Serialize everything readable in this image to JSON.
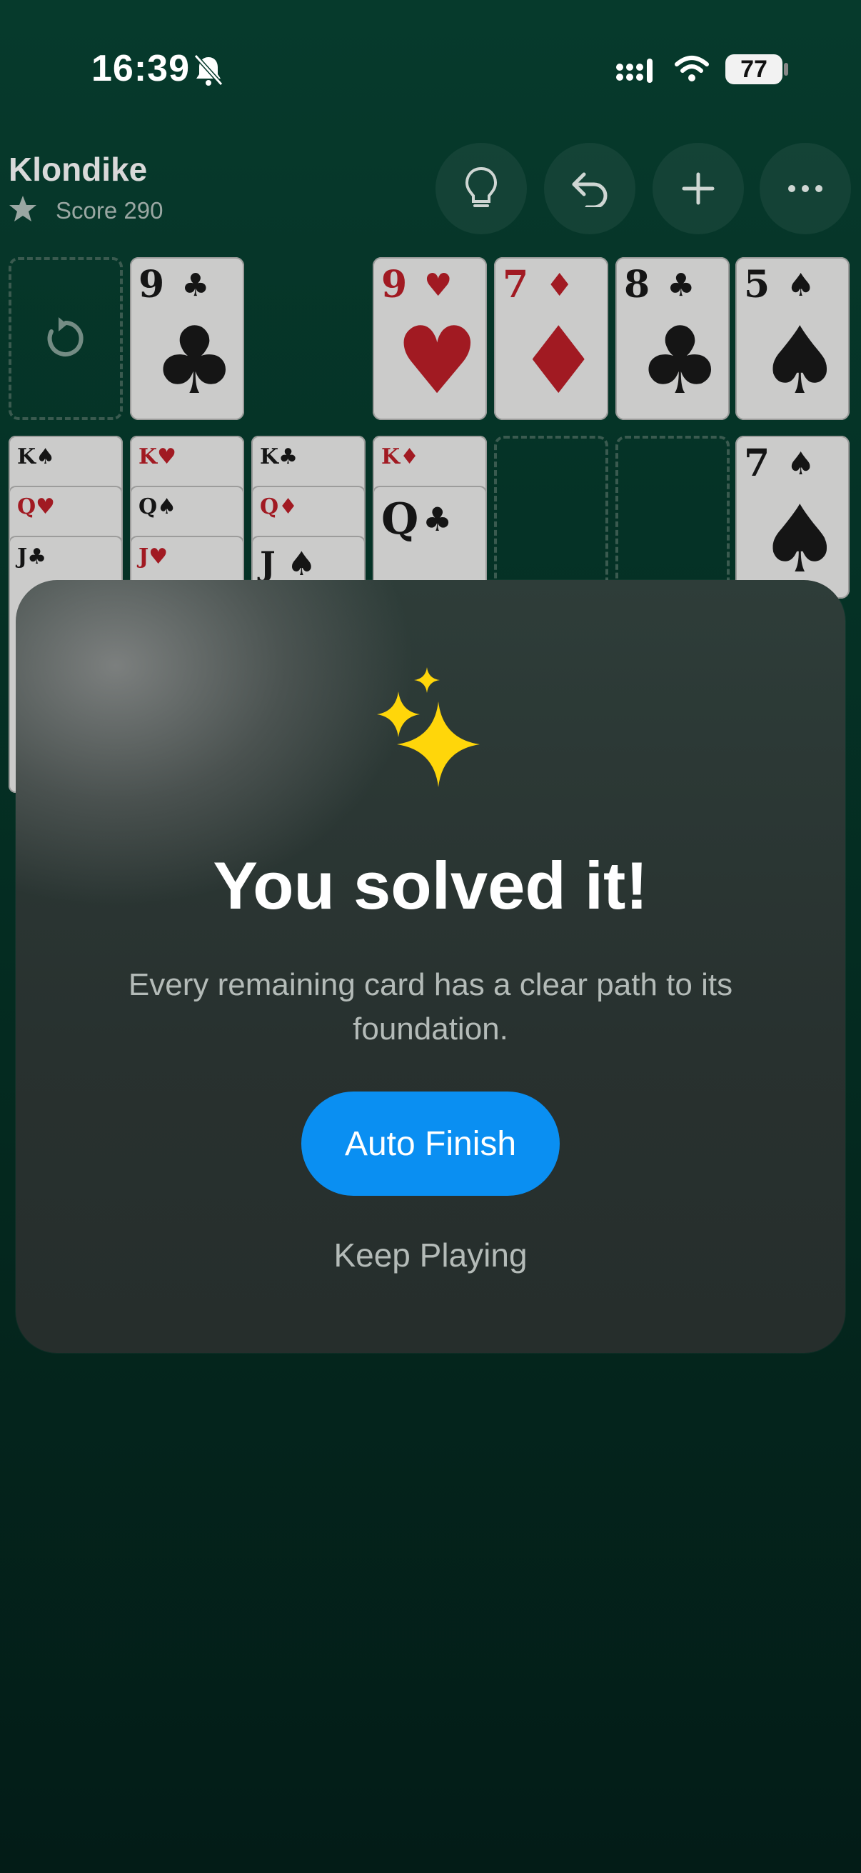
{
  "status_bar": {
    "time": "16:39",
    "battery": "77"
  },
  "header": {
    "title": "Klondike",
    "score_label": "Score 290",
    "buttons": [
      "lightbulb-icon",
      "undo-icon",
      "plus-icon",
      "more-icon"
    ]
  },
  "foundation_cards": [
    {
      "rank": "9",
      "suit": "♣",
      "color": "black"
    },
    {
      "rank": "9",
      "suit": "♥",
      "color": "red"
    },
    {
      "rank": "7",
      "suit": "♦",
      "color": "red"
    },
    {
      "rank": "8",
      "suit": "♣",
      "color": "black"
    },
    {
      "rank": "5",
      "suit": "♠",
      "color": "black"
    }
  ],
  "tableau": {
    "col1": [
      "K♠",
      "Q♥",
      "J♣"
    ],
    "col2": [
      "K♥",
      "Q♠",
      "J♥"
    ],
    "col3": [
      "K♣",
      "Q♦",
      "J ♠"
    ],
    "col4_top": "K♦",
    "col4_card": {
      "rank": "Q",
      "suit": "♣"
    },
    "col7_card": {
      "rank": "7",
      "suit": "♠"
    }
  },
  "dialog": {
    "headline": "You solved it!",
    "message": "Every remaining card has a clear path to its foundation.",
    "primary_button": "Auto Finish",
    "secondary_button": "Keep Playing"
  },
  "colors": {
    "accent": "#0a8ff2",
    "felt": "#063a2c",
    "sparkle": "#ffd60a",
    "card_red": "#a11a22"
  }
}
